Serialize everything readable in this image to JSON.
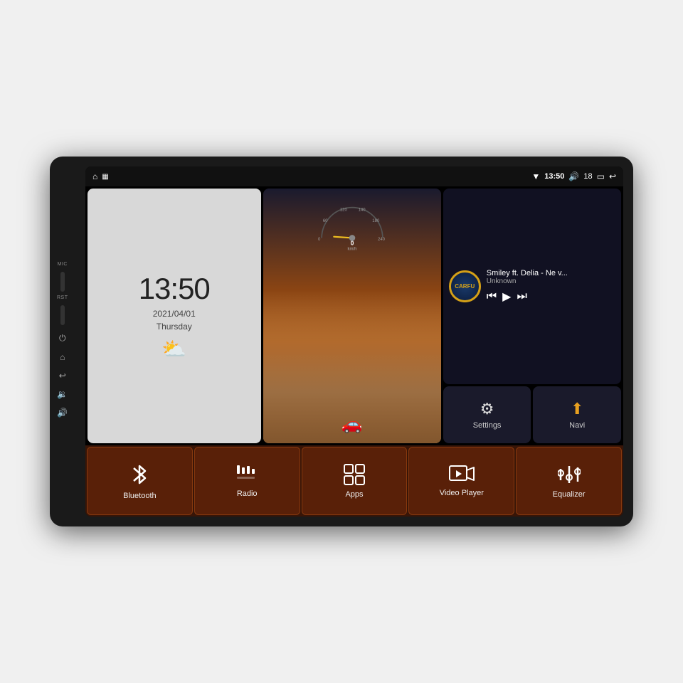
{
  "device": {
    "side_labels": [
      "MIC",
      "RST"
    ]
  },
  "status_bar": {
    "wifi_icon": "▼",
    "time": "13:50",
    "volume_icon": "🔊",
    "volume_level": "18",
    "battery_icon": "🔋",
    "back_icon": "↩",
    "home_icon": "⌂",
    "apps_icon": "▦"
  },
  "clock_widget": {
    "time": "13:50",
    "date": "2021/04/01",
    "day": "Thursday",
    "weather": "⛅"
  },
  "music_widget": {
    "logo_text": "CARFU",
    "title": "Smiley ft. Delia - Ne v...",
    "artist": "Unknown",
    "prev_icon": "⏮",
    "play_icon": "▶",
    "next_icon": "⏭"
  },
  "quick_buttons": [
    {
      "id": "settings",
      "icon": "⚙",
      "label": "Settings"
    },
    {
      "id": "navi",
      "icon": "◬",
      "label": "Navi"
    }
  ],
  "bottom_nav": [
    {
      "id": "bluetooth",
      "icon": "bluetooth",
      "label": "Bluetooth"
    },
    {
      "id": "radio",
      "icon": "radio",
      "label": "Radio"
    },
    {
      "id": "apps",
      "icon": "apps",
      "label": "Apps"
    },
    {
      "id": "video",
      "icon": "video",
      "label": "Video Player"
    },
    {
      "id": "equalizer",
      "icon": "equalizer",
      "label": "Equalizer"
    }
  ],
  "speedometer": {
    "speed": "0",
    "unit": "km/h"
  }
}
